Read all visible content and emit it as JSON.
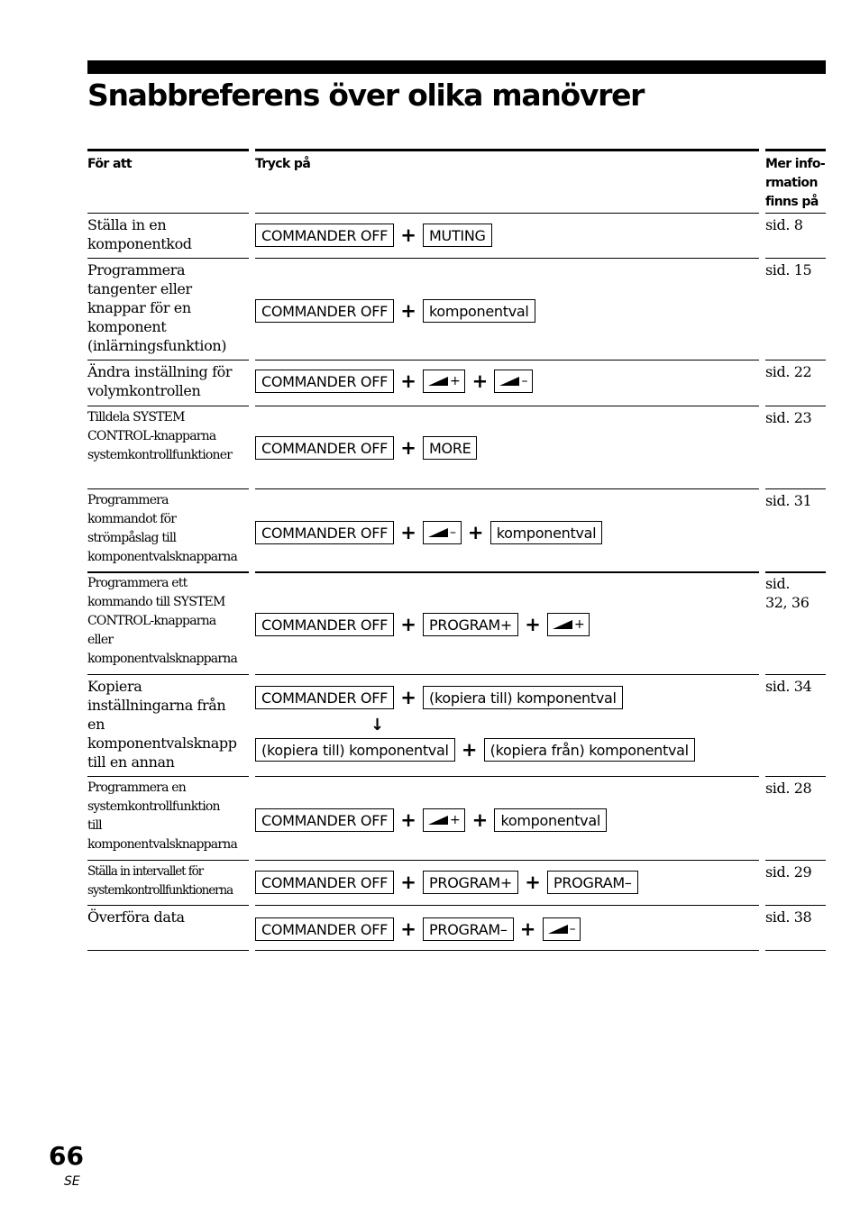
{
  "page": {
    "title": "Snabbreferens över olika manövrer",
    "page_number": "66",
    "language_code": "SE"
  },
  "table": {
    "headers": {
      "action": "För att",
      "press": "Tryck på",
      "more_info_lines": [
        "Mer info-",
        "rmation",
        "finns på"
      ]
    },
    "icons": {
      "volume_up": "volume-up-icon",
      "volume_down": "volume-down-icon",
      "arrow_down": "arrow-down-icon"
    },
    "rows": [
      {
        "action_lines": [
          "Ställa in en",
          "komponentkod"
        ],
        "keys": [
          "COMMANDER OFF",
          "MUTING"
        ],
        "page_ref": [
          "sid. 8"
        ]
      },
      {
        "action_lines": [
          "Programmera",
          "tangenter eller",
          "knappar för en",
          "komponent",
          "(inlärningsfunktion)"
        ],
        "keys": [
          "COMMANDER OFF",
          "komponentval"
        ],
        "page_ref": [
          "sid. 15"
        ]
      },
      {
        "action_lines": [
          "Ändra inställning för",
          "volymkontrollen"
        ],
        "keys": [
          "COMMANDER OFF",
          "VOL+",
          "VOL–"
        ],
        "page_ref": [
          "sid. 22"
        ]
      },
      {
        "action_lines": [
          "Tilldela SYSTEM",
          "CONTROL-knapparna",
          "systemkontrollfunktioner"
        ],
        "keys": [
          "COMMANDER OFF",
          "MORE"
        ],
        "page_ref": [
          "sid. 23"
        ]
      },
      {
        "action_lines": [
          "Programmera",
          "kommandot för",
          "strömpåslag till",
          "komponentvalsknapparna"
        ],
        "keys": [
          "COMMANDER OFF",
          "VOL–",
          "komponentval"
        ],
        "page_ref": [
          "sid. 31"
        ]
      },
      {
        "action_lines": [
          "Programmera ett",
          "kommando till SYSTEM",
          "CONTROL-knapparna",
          "eller",
          "komponentvalsknapparna"
        ],
        "keys": [
          "COMMANDER OFF",
          "PROGRAM+",
          "VOL+"
        ],
        "page_ref": [
          "sid.",
          "32, 36"
        ]
      },
      {
        "action_lines": [
          "Kopiera",
          "inställningarna från",
          "en",
          "komponentvalsknapp",
          "till en annan"
        ],
        "keys": [
          "COMMANDER OFF",
          "(kopiera till) komponentval"
        ],
        "keys_step2": [
          "(kopiera till) komponentval",
          "(kopiera från) komponentval"
        ],
        "page_ref": [
          "sid. 34"
        ]
      },
      {
        "action_lines": [
          "Programmera en",
          "systemkontrollfunktion",
          "till",
          "komponentvalsknapparna"
        ],
        "keys": [
          "COMMANDER OFF",
          "VOL+",
          "komponentval"
        ],
        "page_ref": [
          "sid. 28"
        ]
      },
      {
        "action_lines": [
          "Ställa in intervallet för",
          "systemkontrollfunktionerna"
        ],
        "keys": [
          "COMMANDER OFF",
          "PROGRAM+",
          "PROGRAM–"
        ],
        "page_ref": [
          "sid. 29"
        ]
      },
      {
        "action_lines": [
          "Överföra data"
        ],
        "keys": [
          "COMMANDER OFF",
          "PROGRAM–",
          "VOL–"
        ],
        "page_ref": [
          "sid. 38"
        ]
      }
    ],
    "volume_signs": {
      "up": "+",
      "down": "–"
    },
    "plus_sign": "+"
  }
}
